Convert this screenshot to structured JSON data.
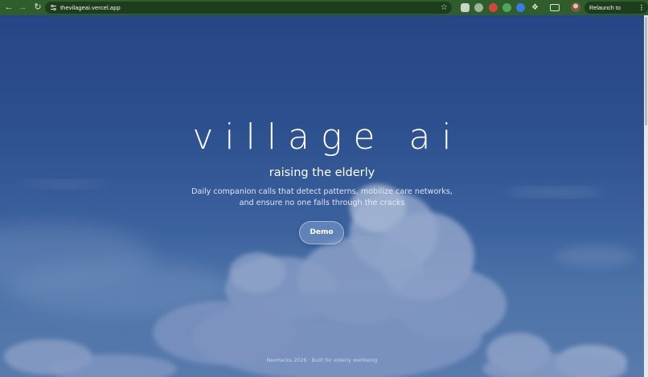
{
  "browser": {
    "url": "thevilageai.vercel.app",
    "relaunch_label": "Relaunch to update",
    "icons": {
      "back": "back-arrow-icon",
      "forward": "forward-arrow-icon",
      "reload": "reload-icon",
      "site_info": "site-settings-icon",
      "bookmark": "star-icon",
      "extensions": "puzzle-icon",
      "menu": "kebab-menu-icon"
    },
    "colors": {
      "toolbar": "#2f5d2c",
      "omnibox": "#1e3d1c"
    }
  },
  "hero": {
    "title": "village ai",
    "subtitle": "raising the elderly",
    "description_line1": "Daily companion calls that detect patterns, mobilize care networks,",
    "description_line2": "and ensure no one falls through the cracks",
    "demo_button": "Demo"
  },
  "footer": {
    "text": "NexHacks 2026 · Built for elderly wellbeing"
  }
}
